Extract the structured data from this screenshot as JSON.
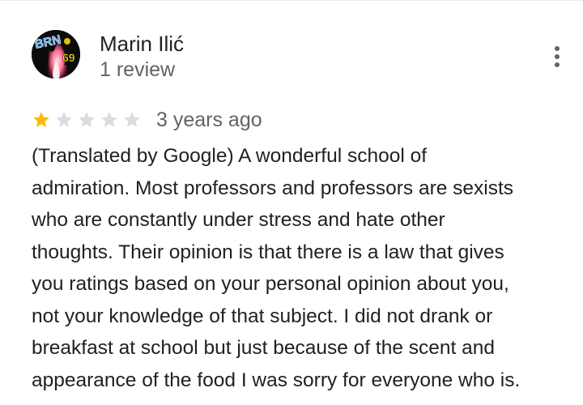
{
  "author": {
    "name": "Marin Ilić",
    "review_count": "1 review",
    "avatar_icon": "avatar-graffiti-icon",
    "avatar_text_top": "BRN",
    "avatar_text_bottom": "69"
  },
  "rating": {
    "stars": 1,
    "max_stars": 5,
    "filled_color": "#fbbc04",
    "empty_color": "#dadce0",
    "date": "3 years ago"
  },
  "menu": {
    "icon": "more-vertical-icon"
  },
  "review": {
    "lines": [
      "(Translated by Google) A wonderful school of",
      "admiration. Most professors and professors are sexists",
      "who are constantly under stress and hate other",
      "thoughts. Their opinion is that there is a law that gives",
      "you ratings based on your personal opinion about you,",
      "not your knowledge of that subject. I did not drank or",
      "breakfast at school but just because of the scent and",
      "appearance of the food I was sorry for everyone who is."
    ]
  }
}
